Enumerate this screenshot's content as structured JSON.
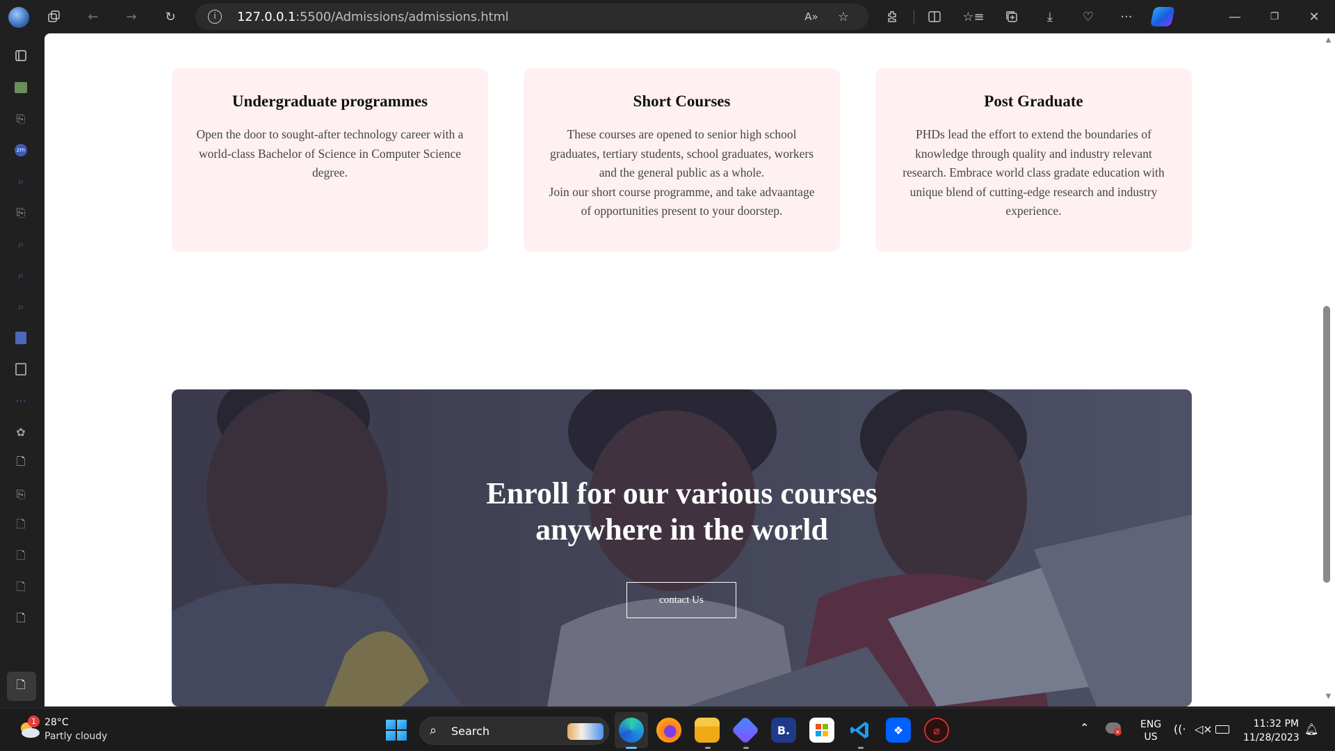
{
  "browser": {
    "url_host": "127.0.0.1",
    "url_path": ":5500/Admissions/admissions.html"
  },
  "cards": [
    {
      "title": "Undergraduate programmes",
      "lines": [
        "Open the door to sought-after technology career with a",
        "world-class Bachelor of Science in Computer Science",
        "degree."
      ]
    },
    {
      "title": "Short Courses",
      "lines": [
        "These courses are opened to senior high school",
        "graduates, tertiary students, school graduates, workers",
        "and the general public as a whole.",
        "Join our short course programme, and take advaantage",
        "of opportunities present to your doorstep."
      ]
    },
    {
      "title": "Post Graduate",
      "lines": [
        "PHDs lead the effort to extend the boundaries of",
        "knowledge through quality and industry relevant",
        "research. Embrace world class gradate education with",
        "unique blend of cutting-edge research and industry",
        "experience."
      ]
    }
  ],
  "hero": {
    "title_line1": "Enroll for our various courses",
    "title_line2": "anywhere in the world",
    "button_label": "contact Us"
  },
  "taskbar": {
    "weather_badge": "1",
    "temperature": "28°C",
    "weather": "Partly cloudy",
    "search_label": "Search",
    "language": "ENG",
    "region": "US",
    "time": "11:32 PM",
    "date": "11/28/2023"
  },
  "icons": {
    "browser_toolbar": [
      "profile-icon",
      "workspaces-icon",
      "back-icon",
      "forward-icon",
      "refresh-icon",
      "read-aloud-icon",
      "favorite-star-icon",
      "extensions-icon",
      "split-screen-icon",
      "favorites-icon",
      "collections-icon",
      "downloads-icon",
      "browser-essentials-icon",
      "more-icon",
      "copilot-icon"
    ],
    "window_controls": [
      "minimize-icon",
      "restore-icon",
      "close-icon"
    ]
  },
  "colors": {
    "card_bg": "#fff1f1",
    "hero_overlay": "#3d4150",
    "taskbar_bg": "#1c1c1c"
  }
}
